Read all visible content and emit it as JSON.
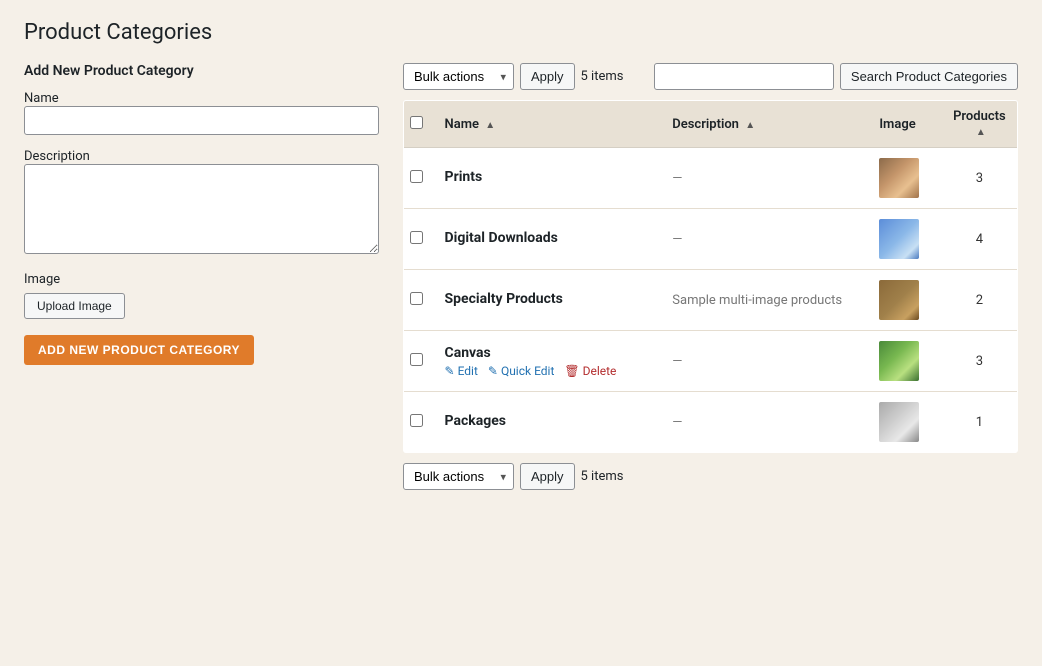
{
  "page": {
    "title": "Product Categories"
  },
  "left_panel": {
    "add_new_title": "Add New Product Category",
    "name_label": "Name",
    "name_placeholder": "",
    "description_label": "Description",
    "description_placeholder": "",
    "image_label": "Image",
    "upload_btn_label": "Upload Image",
    "add_btn_label": "ADD NEW PRODUCT CATEGORY"
  },
  "toolbar_top": {
    "bulk_actions_label": "Bulk actions",
    "apply_label": "Apply",
    "search_placeholder": "",
    "search_btn_label": "Search Product Categories",
    "items_count": "5 items"
  },
  "toolbar_bottom": {
    "bulk_actions_label": "Bulk actions",
    "apply_label": "Apply",
    "items_count": "5 items"
  },
  "table": {
    "headers": {
      "name": "Name",
      "description": "Description",
      "image": "Image",
      "products": "Products"
    },
    "rows": [
      {
        "id": 1,
        "name": "Prints",
        "description": "—",
        "thumb_class": "thumb-prints",
        "thumb_emoji": "🖼️",
        "products": "3",
        "show_actions": false
      },
      {
        "id": 2,
        "name": "Digital Downloads",
        "description": "—",
        "thumb_class": "thumb-digital",
        "thumb_emoji": "🌊",
        "products": "4",
        "show_actions": false
      },
      {
        "id": 3,
        "name": "Specialty Products",
        "description": "Sample multi-image products",
        "thumb_class": "thumb-specialty",
        "thumb_emoji": "🧰",
        "products": "2",
        "show_actions": false
      },
      {
        "id": 4,
        "name": "Canvas",
        "description": "—",
        "thumb_class": "thumb-canvas",
        "thumb_emoji": "🌿",
        "products": "3",
        "show_actions": true
      },
      {
        "id": 5,
        "name": "Packages",
        "description": "—",
        "thumb_class": "thumb-packages",
        "thumb_emoji": "🖼️",
        "products": "1",
        "show_actions": false
      }
    ],
    "row_actions": {
      "edit": "Edit",
      "quick_edit": "Quick Edit",
      "delete": "Delete"
    }
  }
}
